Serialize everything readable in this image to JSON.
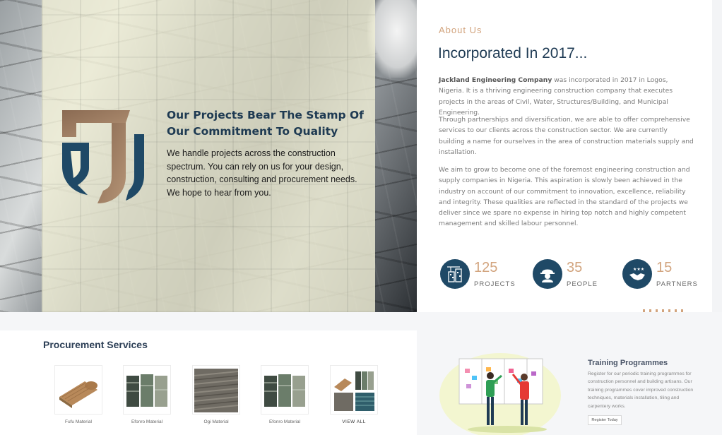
{
  "hero": {
    "heading": "Our Projects Bear The Stamp Of Our Commitment To Quality",
    "text": "We handle projects across the construction spectrum. You can rely on us for your design, construction, consulting and procurement needs. We hope to hear from you."
  },
  "about": {
    "label": "About Us",
    "title": "Incorporated In 2017...",
    "p1_company": "Jackland Engineering Company",
    "p1_rest": " was incorporated in 2017 in Logos, Nigeria. It is a thriving engineering construction company that executes projects in the areas of Civil, Water, Structures/Building, and Municipal Engineering.",
    "p2": "Through partnerships and diversification, we are able to offer comprehensive services to our clients across the construction sector. We are currently building a name for ourselves in the area of construction materials supply and installation.",
    "p3": "We aim to grow to become one of the foremost engineering construction and supply companies in Nigeria. This aspiration is slowly been achieved in the industry on account of our commitment to innovation, excellence, reliability and integrity. These qualities are reflected in the standard of the projects we deliver since we spare no expense in hiring top notch and highly competent management and skilled labour personnel.",
    "stats": [
      {
        "value": "125",
        "label": "PROJECTS",
        "icon": "building-crane-icon"
      },
      {
        "value": "35",
        "label": "PEOPLE",
        "icon": "worker-helmet-icon"
      },
      {
        "value": "15",
        "label": "PARTNERS",
        "icon": "handshake-icon"
      }
    ]
  },
  "procurement": {
    "title": "Procurement Services",
    "items": [
      {
        "caption": "Fufu Material"
      },
      {
        "caption": "Efonro Material"
      },
      {
        "caption": "Ogi Material"
      },
      {
        "caption": "Efonro Material"
      },
      {
        "caption": "VIEW ALL"
      }
    ]
  },
  "training": {
    "title": "Training Programmes",
    "text": "Register for our periodic training programmes for construction personnel and building artisans. Our training programmes cover improved construction techniques, materials installation, tiling and carpentery works.",
    "button": "Register Today"
  },
  "colors": {
    "navy": "#1f3b54",
    "accent": "#d2a47e",
    "icon_bg": "#1f4966"
  }
}
